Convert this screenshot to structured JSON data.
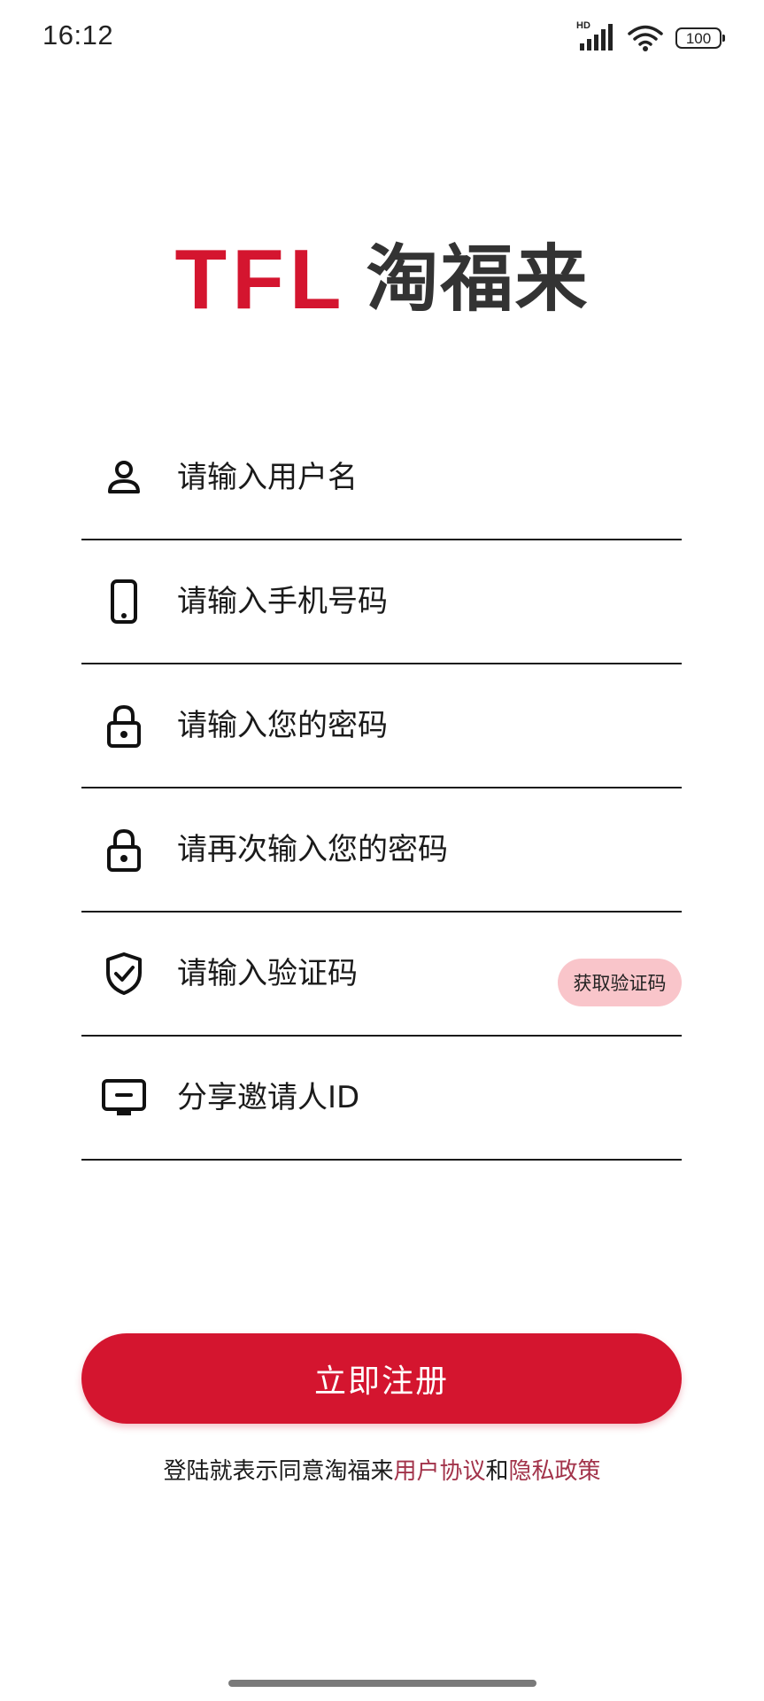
{
  "status_bar": {
    "time": "16:12",
    "network_label": "HD",
    "battery": "100",
    "icons": [
      "signal-icon",
      "wifi-icon",
      "battery-icon"
    ]
  },
  "logo": {
    "en": "TFL",
    "cn": "淘福来"
  },
  "form": {
    "username_placeholder": "请输入用户名",
    "phone_placeholder": "请输入手机号码",
    "password_placeholder": "请输入您的密码",
    "confirm_password_placeholder": "请再次输入您的密码",
    "verification_placeholder": "请输入验证码",
    "get_code_label": "获取验证码",
    "invite_placeholder": "分享邀请人ID"
  },
  "register_button": "立即注册",
  "agreement": {
    "prefix": "登陆就表示同意淘福来",
    "user_agreement": "用户协议",
    "and": "和",
    "privacy_policy": "隐私政策"
  },
  "colors": {
    "brand_red": "#d4152f",
    "button_pink": "#f9c5ca",
    "link_color": "#a2334a"
  }
}
